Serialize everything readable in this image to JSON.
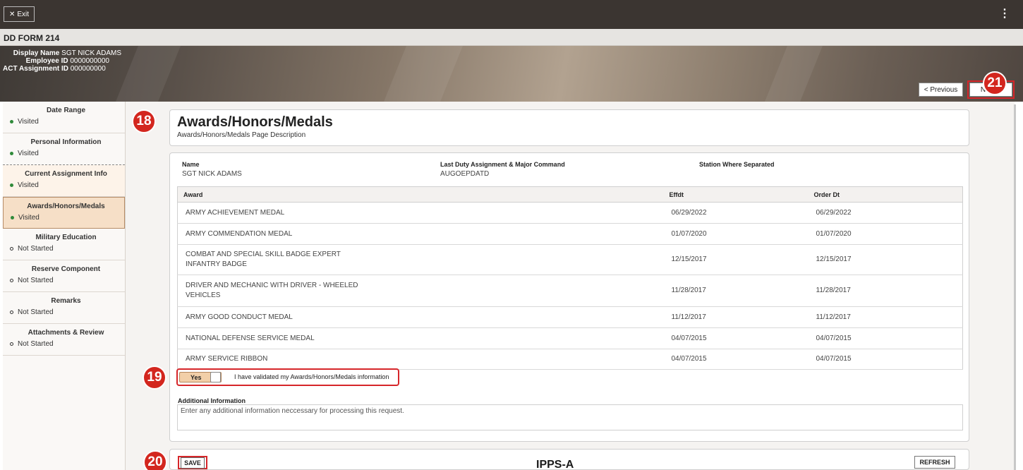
{
  "header": {
    "exit_label": "Exit",
    "menu_icon": "kebab-icon"
  },
  "title": "DD FORM 214",
  "employee": {
    "display_name_label": "Display Name",
    "display_name": "SGT NICK ADAMS",
    "employee_id_label": "Employee ID",
    "employee_id": "0000000000",
    "act_assignment_label": "ACT Assignment ID",
    "act_assignment": "000000000"
  },
  "nav": {
    "previous": "< Previous",
    "next": "Next >"
  },
  "callouts": {
    "c18": "18",
    "c19": "19",
    "c20": "20",
    "c21": "21"
  },
  "sidebar": {
    "items": [
      {
        "label": "Date Range",
        "status": "Visited"
      },
      {
        "label": "Personal Information",
        "status": "Visited"
      },
      {
        "label": "Current Assignment Info",
        "status": "Visited"
      },
      {
        "label": "Awards/Honors/Medals",
        "status": "Visited"
      },
      {
        "label": "Military Education",
        "status": "Not Started"
      },
      {
        "label": "Reserve Component",
        "status": "Not Started"
      },
      {
        "label": "Remarks",
        "status": "Not Started"
      },
      {
        "label": "Attachments & Review",
        "status": "Not Started"
      }
    ]
  },
  "page": {
    "heading": "Awards/Honors/Medals",
    "description": "Awards/Honors/Medals Page Description"
  },
  "info": {
    "name_label": "Name",
    "name_value": "SGT NICK ADAMS",
    "duty_label": "Last Duty Assignment & Major Command",
    "duty_value": "AUGOEPDATD",
    "station_label": "Station Where Separated",
    "station_value": ""
  },
  "table": {
    "headers": {
      "award": "Award",
      "effdt": "Effdt",
      "order_dt": "Order Dt"
    },
    "rows": [
      {
        "award_line1": "ARMY ACHIEVEMENT MEDAL",
        "award_line2": "",
        "effdt": "06/29/2022",
        "order_dt": "06/29/2022"
      },
      {
        "award_line1": "ARMY COMMENDATION MEDAL",
        "award_line2": "",
        "effdt": "01/07/2020",
        "order_dt": "01/07/2020"
      },
      {
        "award_line1": "COMBAT AND SPECIAL SKILL BADGE EXPERT",
        "award_line2": "INFANTRY BADGE",
        "effdt": "12/15/2017",
        "order_dt": "12/15/2017"
      },
      {
        "award_line1": "DRIVER AND MECHANIC WITH DRIVER - WHEELED",
        "award_line2": "VEHICLES",
        "effdt": "11/28/2017",
        "order_dt": "11/28/2017"
      },
      {
        "award_line1": "ARMY GOOD CONDUCT MEDAL",
        "award_line2": "",
        "effdt": "11/12/2017",
        "order_dt": "11/12/2017"
      },
      {
        "award_line1": "NATIONAL DEFENSE SERVICE MEDAL",
        "award_line2": "",
        "effdt": "04/07/2015",
        "order_dt": "04/07/2015"
      },
      {
        "award_line1": "ARMY SERVICE RIBBON",
        "award_line2": "",
        "effdt": "04/07/2015",
        "order_dt": "04/07/2015"
      }
    ]
  },
  "validation": {
    "toggle_label": "Yes",
    "text": "I have validated my Awards/Honors/Medals information"
  },
  "additional": {
    "label": "Additional Information",
    "placeholder": "Enter any additional information neccessary for processing this request."
  },
  "footer": {
    "save": "SAVE",
    "refresh": "REFRESH",
    "logo": "IPPS-A"
  },
  "colors": {
    "accent_red": "#d6262a",
    "active_tab": "#f6dfc7",
    "visited_dot": "#2f8a3a"
  }
}
